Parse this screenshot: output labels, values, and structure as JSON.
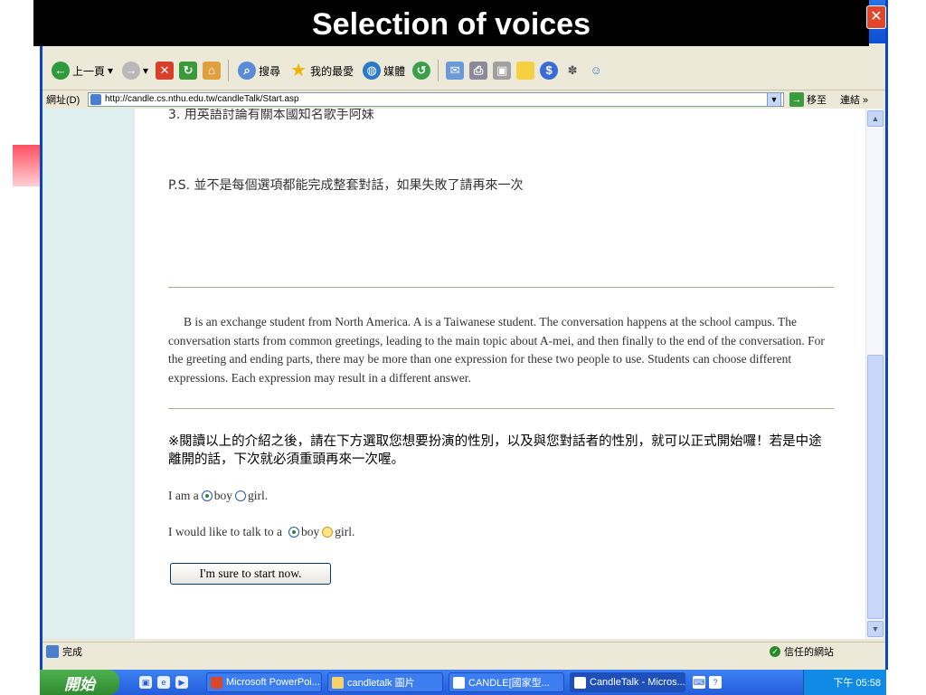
{
  "slide": {
    "title": "Selection of voices"
  },
  "toolbar": {
    "back_label": "上一頁",
    "search_label": "搜尋",
    "favorites_label": "我的最愛",
    "media_label": "媒體"
  },
  "address": {
    "label": "網址(D)",
    "url": "http://candle.cs.nthu.edu.tw/candleTalk/Start.asp",
    "go_label": "移至",
    "links_label": "連結 »"
  },
  "page": {
    "item3_text": "3. 用英語討論有關本國知名歌手阿妹",
    "ps_text": "P.S. 並不是每個選項都能完成整套對話，如果失敗了請再來一次",
    "intro_text": "B is an exchange student from North America. A is a Taiwanese student. The conversation happens at the school campus. The conversation starts from common greetings, leading to the main topic about A-mei, and then finally to the end of the conversation. For the greeting and ending parts, there may be more than one expression for these two people to use. Students can choose different expressions. Each expression may result in a different answer.",
    "instruction_text": "※閱讀以上的介紹之後，請在下方選取您想要扮演的性別，以及與您對話者的性別，就可以正式開始囉！若是中途離開的話，下次就必須重頭再來一次喔。",
    "role_prefix": "I am a",
    "partner_prefix": "I would like to talk to a",
    "opt_boy": "boy",
    "opt_girl_role": "girl.",
    "opt_girl_partner": "girl.",
    "role_selected": "boy",
    "partner_selected": "boy",
    "submit_label": "I'm sure to start now."
  },
  "status": {
    "text": "完成",
    "zone": "信任的網站"
  },
  "taskbar": {
    "start_label": "開始",
    "tasks": [
      {
        "label": "Microsoft PowerPoi..."
      },
      {
        "label": "candletalk 圖片"
      },
      {
        "label": "CANDLE[國家型..."
      },
      {
        "label": "CandleTalk - Micros..."
      }
    ],
    "clock": "下午 05:58"
  },
  "colors": {
    "title_bg": "#000000",
    "window_frame": "#0a46c4",
    "left_column": "#dfeeee",
    "taskbar": "#245edb"
  }
}
